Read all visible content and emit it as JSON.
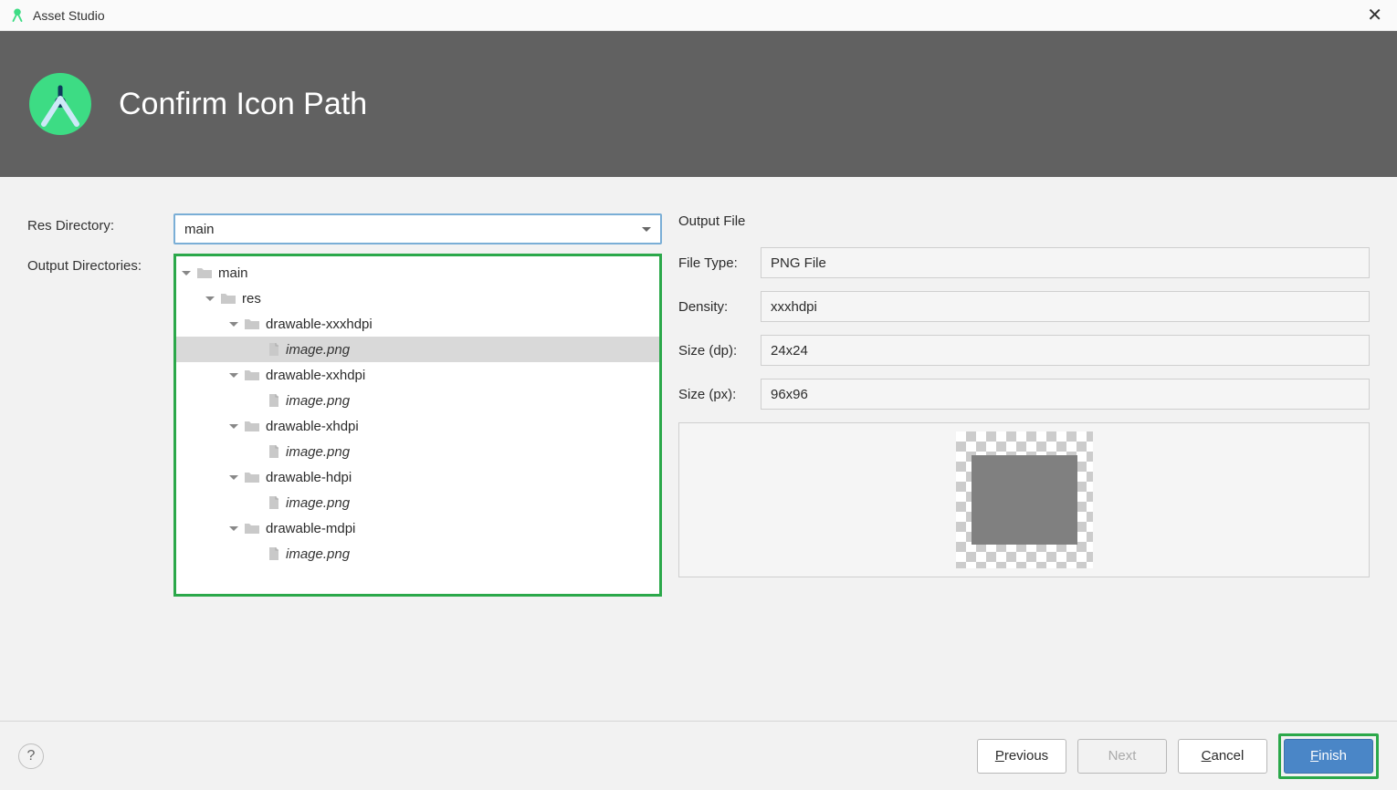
{
  "window": {
    "title": "Asset Studio"
  },
  "banner": {
    "heading": "Confirm Icon Path"
  },
  "labels": {
    "res_directory": "Res Directory:",
    "output_directories": "Output Directories:",
    "output_file": "Output File",
    "file_type": "File Type:",
    "density": "Density:",
    "size_dp": "Size (dp):",
    "size_px": "Size (px):"
  },
  "dropdown": {
    "res_directory_value": "main"
  },
  "tree": [
    {
      "depth": 0,
      "expander": true,
      "icon": "folder",
      "label": "main",
      "italic": false,
      "selected": false
    },
    {
      "depth": 1,
      "expander": true,
      "icon": "folder",
      "label": "res",
      "italic": false,
      "selected": false
    },
    {
      "depth": 2,
      "expander": true,
      "icon": "folder",
      "label": "drawable-xxxhdpi",
      "italic": false,
      "selected": false
    },
    {
      "depth": 3,
      "expander": false,
      "icon": "file",
      "label": "image.png",
      "italic": true,
      "selected": true
    },
    {
      "depth": 2,
      "expander": true,
      "icon": "folder",
      "label": "drawable-xxhdpi",
      "italic": false,
      "selected": false
    },
    {
      "depth": 3,
      "expander": false,
      "icon": "file",
      "label": "image.png",
      "italic": true,
      "selected": false
    },
    {
      "depth": 2,
      "expander": true,
      "icon": "folder",
      "label": "drawable-xhdpi",
      "italic": false,
      "selected": false
    },
    {
      "depth": 3,
      "expander": false,
      "icon": "file",
      "label": "image.png",
      "italic": true,
      "selected": false
    },
    {
      "depth": 2,
      "expander": true,
      "icon": "folder",
      "label": "drawable-hdpi",
      "italic": false,
      "selected": false
    },
    {
      "depth": 3,
      "expander": false,
      "icon": "file",
      "label": "image.png",
      "italic": true,
      "selected": false
    },
    {
      "depth": 2,
      "expander": true,
      "icon": "folder",
      "label": "drawable-mdpi",
      "italic": false,
      "selected": false
    },
    {
      "depth": 3,
      "expander": false,
      "icon": "file",
      "label": "image.png",
      "italic": true,
      "selected": false
    }
  ],
  "output": {
    "file_type": "PNG File",
    "density": "xxxhdpi",
    "size_dp": "24x24",
    "size_px": "96x96"
  },
  "buttons": {
    "previous": "Previous",
    "next": "Next",
    "cancel": "Cancel",
    "finish": "Finish",
    "help": "?"
  }
}
